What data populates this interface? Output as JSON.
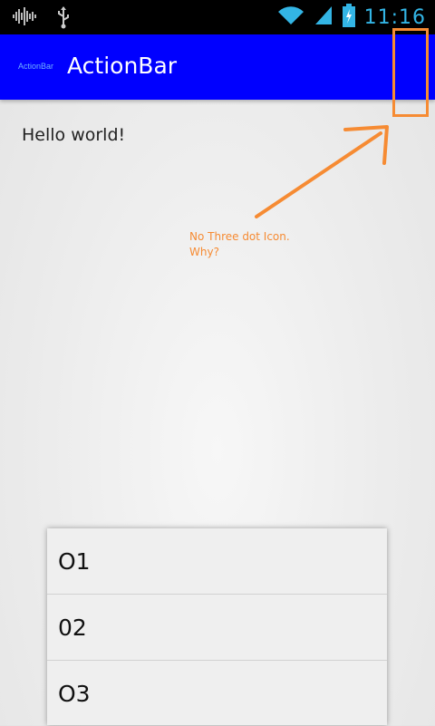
{
  "status_bar": {
    "time": "11:16",
    "icons": [
      "signal-activity-icon",
      "usb-icon",
      "wifi-icon",
      "cell-signal-icon",
      "battery-charging-icon"
    ]
  },
  "action_bar": {
    "logo_text": "ActionBar",
    "title": "ActionBar",
    "background": "#0000ff"
  },
  "content": {
    "hello_text": "Hello world!"
  },
  "annotation": {
    "line1": "No Three dot Icon.",
    "line2": "Why?",
    "color": "#f68b33"
  },
  "overflow_menu": {
    "items": [
      {
        "label": "O1"
      },
      {
        "label": "02"
      },
      {
        "label": "O3"
      }
    ]
  }
}
